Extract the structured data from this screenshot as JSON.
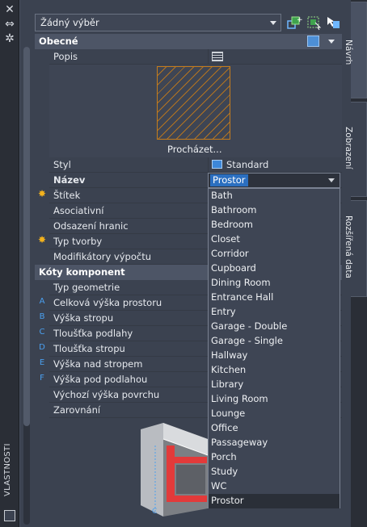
{
  "left_strip": {
    "title": "VLASTNOSTI"
  },
  "selection": {
    "value": "Žádný výběr"
  },
  "sections": {
    "general": "Obecné",
    "component_dims": "Kóty komponent"
  },
  "general_rows": {
    "description": "Popis",
    "browse": "Procházet...",
    "style": "Styl",
    "style_value": "Standard",
    "name": "Název",
    "name_value": "Prostor",
    "tag": "Štítek",
    "associative": "Asociativní",
    "boundary_offset": "Odsazení hranic",
    "creation_type": "Typ tvorby",
    "calc_modifiers": "Modifikátory výpočtu"
  },
  "dim_rows": [
    {
      "marker": "",
      "label": "Typ geometrie"
    },
    {
      "marker": "A",
      "label": "Celková výška prostoru"
    },
    {
      "marker": "B",
      "label": "Výška stropu"
    },
    {
      "marker": "C",
      "label": "Tloušťka podlahy"
    },
    {
      "marker": "D",
      "label": "Tloušťka stropu"
    },
    {
      "marker": "E",
      "label": "Výška nad stropem"
    },
    {
      "marker": "F",
      "label": "Výška pod podlahou"
    },
    {
      "marker": "",
      "label": "Výchozí výška povrchu"
    },
    {
      "marker": "",
      "label": "Zarovnání"
    }
  ],
  "dropdown": {
    "items": [
      "Bath",
      "Bathroom",
      "Bedroom",
      "Closet",
      "Corridor",
      "Cupboard",
      "Dining Room",
      "Entrance Hall",
      "Entry",
      "Garage - Double",
      "Garage - Single",
      "Hallway",
      "Kitchen",
      "Library",
      "Living Room",
      "Lounge",
      "Office",
      "Passageway",
      "Porch",
      "Study",
      "WC",
      "Prostor"
    ],
    "selected": "Prostor"
  },
  "right_tabs": [
    "Návrh",
    "Zobrazení",
    "Rozšířená data"
  ],
  "colors": {
    "accent": "#2b6fc0",
    "hatch": "#c67d1c",
    "star": "#f3b21d",
    "marker": "#4aa0f0"
  },
  "icons": [
    "close-icon",
    "pin-icon",
    "settings-icon",
    "quick-select-icon",
    "select-objects-icon",
    "toggle-pickadd-icon",
    "table-icon",
    "style-icon"
  ]
}
